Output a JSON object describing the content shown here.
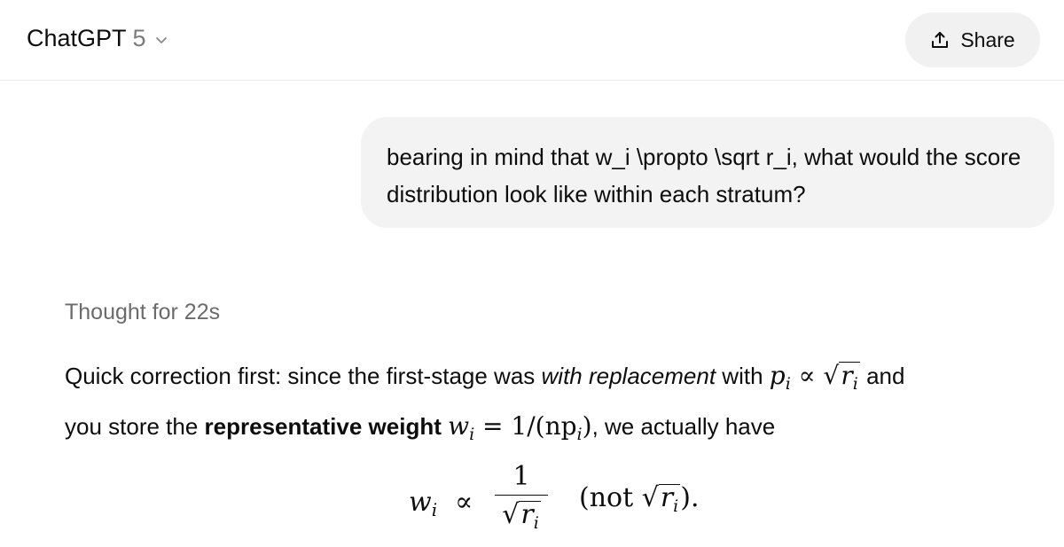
{
  "header": {
    "model_name": "ChatGPT",
    "model_version": "5",
    "share_label": "Share"
  },
  "conversation": {
    "user_message": "bearing in mind that w_i \\propto \\sqrt r_i, what would the score distribution look like within each stratum?",
    "thought_label": "Thought for 22s",
    "answer": {
      "p1_part1": "Quick correction first: since the first-stage was ",
      "p1_italic": "with replacement",
      "p1_part2": " with ",
      "p1_part3": " and",
      "p1_part4": "you store the ",
      "p1_bold": "representative weight",
      "p1_part5": ", we actually have",
      "m_p": "p",
      "m_i": "i",
      "m_prop": "∝",
      "m_r": "r",
      "m_w": "w",
      "m_eq_rhs": "= 1/(np",
      "m_close": ")",
      "dm_num": "1",
      "dm_not_open": "(not ",
      "dm_not_close": ")."
    }
  },
  "colors": {
    "muted": "#6b6b6b",
    "bubble_bg": "#f3f3f3",
    "share_bg": "#f1f1f1",
    "divider": "#ececec"
  },
  "icons": {
    "chevron": "chevron-down-icon",
    "share": "share-icon"
  }
}
